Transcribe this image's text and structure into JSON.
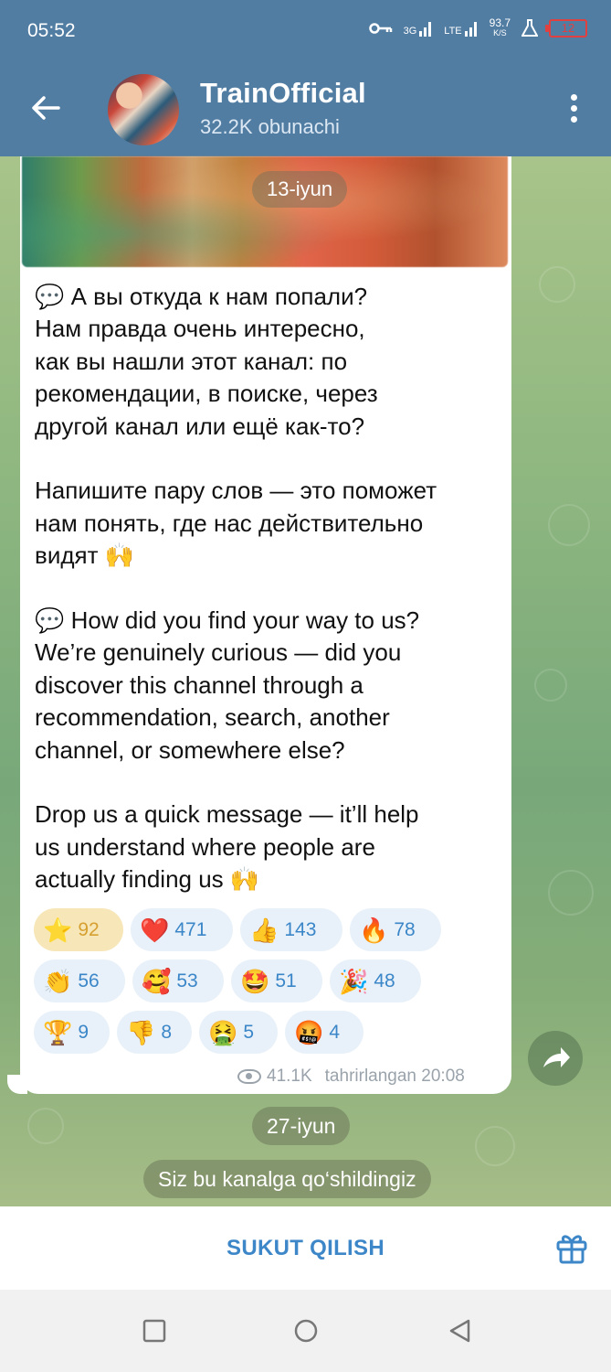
{
  "status_bar": {
    "time": "05:52",
    "net_3g": "3G",
    "net_lte": "LTE",
    "speed_value": "93.7",
    "speed_unit": "K/S",
    "battery": "12"
  },
  "header": {
    "title": "TrainOfficial",
    "subtitle": "32.2K obunachi"
  },
  "message": {
    "photo_date": "13-iyun",
    "paragraphs": [
      "💬 А вы откуда к нам попали?\nНам правда очень интересно,\nкак вы нашли этот канал: по\nрекомендации, в поиске, через\nдругой канал или ещё как-то?",
      "Напишите пару слов — это поможет\nнам понять, где нас действительно\nвидят 🙌",
      "💬 How did you find your way to us?\nWe’re genuinely curious — did you\ndiscover this channel through a\nrecommendation, search, another\nchannel, or somewhere else?",
      "Drop us a quick message — it’ll help\nus understand where people are\nactually finding us 🙌"
    ],
    "reactions": [
      [
        {
          "emoji": "⭐",
          "count": "92",
          "active": true
        },
        {
          "emoji": "❤️",
          "count": "471"
        },
        {
          "emoji": "👍",
          "count": "143"
        },
        {
          "emoji": "🔥",
          "count": "78"
        }
      ],
      [
        {
          "emoji": "👏",
          "count": "56"
        },
        {
          "emoji": "🥰",
          "count": "53"
        },
        {
          "emoji": "🤩",
          "count": "51"
        },
        {
          "emoji": "🎉",
          "count": "48"
        }
      ],
      [
        {
          "emoji": "🏆",
          "count": "9"
        },
        {
          "emoji": "👎",
          "count": "8"
        },
        {
          "emoji": "🤮",
          "count": "5"
        },
        {
          "emoji": "🤬",
          "count": "4"
        }
      ]
    ],
    "views": "41.1K",
    "edited_time": "tahrirlangan 20:08"
  },
  "service": {
    "date": "27-iyun",
    "joined": "Siz bu kanalga qo‘shildingiz"
  },
  "bottom": {
    "mute_label": "SUKUT QILISH"
  },
  "colors": {
    "header": "#527da3",
    "accent": "#3d87c8",
    "reaction_bg": "#e8f1f9",
    "reaction_active_bg": "#f7e6b8"
  },
  "icons": {
    "back": "arrow-left-icon",
    "menu": "more-vertical-icon",
    "share": "share-arrow-icon",
    "gift": "gift-icon",
    "views": "eye-icon"
  }
}
